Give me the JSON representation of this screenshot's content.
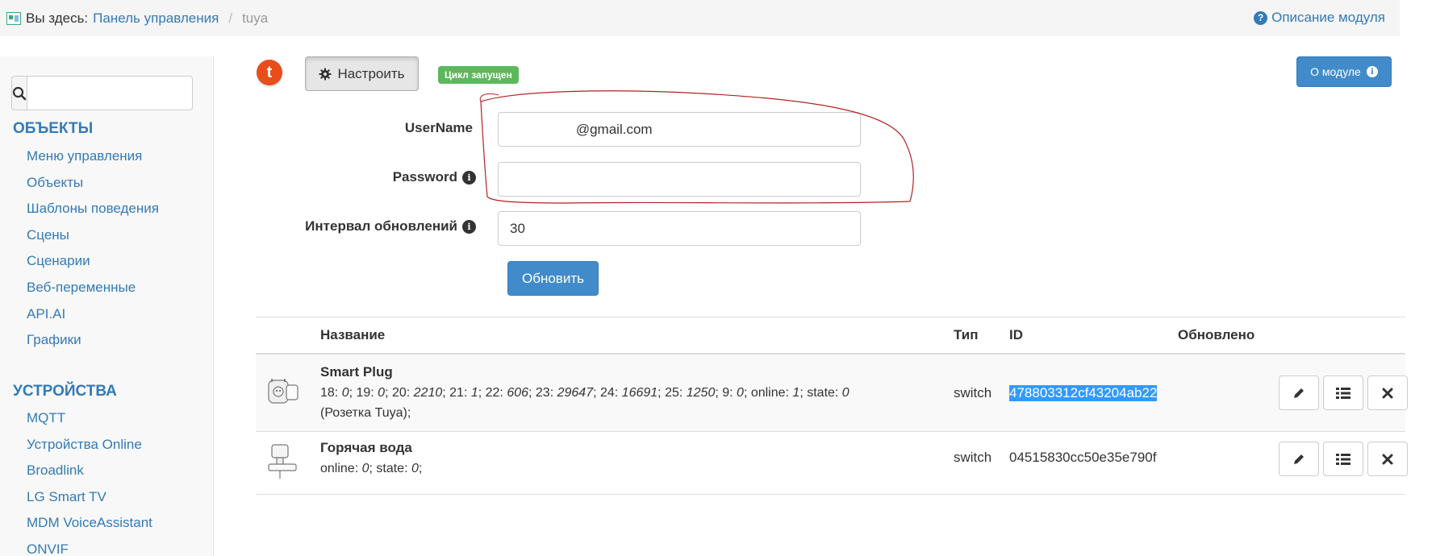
{
  "breadcrumb": {
    "label": "Вы здесь:",
    "home": "Панель управления",
    "separator": "/",
    "current": "tuya",
    "help_link": "Описание модуля"
  },
  "sidebar": {
    "search_placeholder": "",
    "sections": [
      {
        "title": "ОБЪЕКТЫ",
        "items": [
          "Меню управления",
          "Объекты",
          "Шаблоны поведения",
          "Сцены",
          "Сценарии",
          "Веб-переменные",
          "API.AI",
          "Графики"
        ]
      },
      {
        "title": "УСТРОЙСТВА",
        "items": [
          "MQTT",
          "Устройства Online",
          "Broadlink",
          "LG Smart TV",
          "MDM VoiceAssistant",
          "ONVIF"
        ]
      }
    ]
  },
  "header": {
    "logo_letter": "t",
    "configure_label": "Настроить",
    "status_badge": "Цикл запущен",
    "about_label": "О модуле"
  },
  "form": {
    "username_label": "UserName",
    "username_value": "               @gmail.com",
    "password_label": "Password",
    "password_value": "",
    "interval_label": "Интервал обновлений",
    "interval_value": "30",
    "submit_label": "Обновить"
  },
  "table": {
    "columns": [
      "Название",
      "Тип",
      "ID",
      "Обновлено"
    ],
    "rows": [
      {
        "name": "Smart Plug",
        "props": [
          [
            "18",
            "0"
          ],
          [
            "19",
            "0"
          ],
          [
            "20",
            "2210"
          ],
          [
            "21",
            "1"
          ],
          [
            "22",
            "606"
          ],
          [
            "23",
            "29647"
          ],
          [
            "24",
            "16691"
          ],
          [
            "25",
            "1250"
          ],
          [
            "9",
            "0"
          ],
          [
            "online",
            "1"
          ],
          [
            "state",
            "0"
          ]
        ],
        "props_suffix": "(Розетка Tuya);",
        "type": "switch",
        "id": "478803312cf43204ab22",
        "updated": ""
      },
      {
        "name": "Горячая вода",
        "props": [
          [
            "online",
            "0"
          ],
          [
            "state",
            "0"
          ]
        ],
        "props_suffix": "",
        "type": "switch",
        "id": "04515830cc50e35e790f",
        "updated": ""
      }
    ]
  },
  "colors": {
    "link": "#337ab7",
    "primary_button": "#428bca",
    "success_badge": "#5cb85c",
    "annotation": "#c0392b",
    "selection": "#3399ff"
  }
}
